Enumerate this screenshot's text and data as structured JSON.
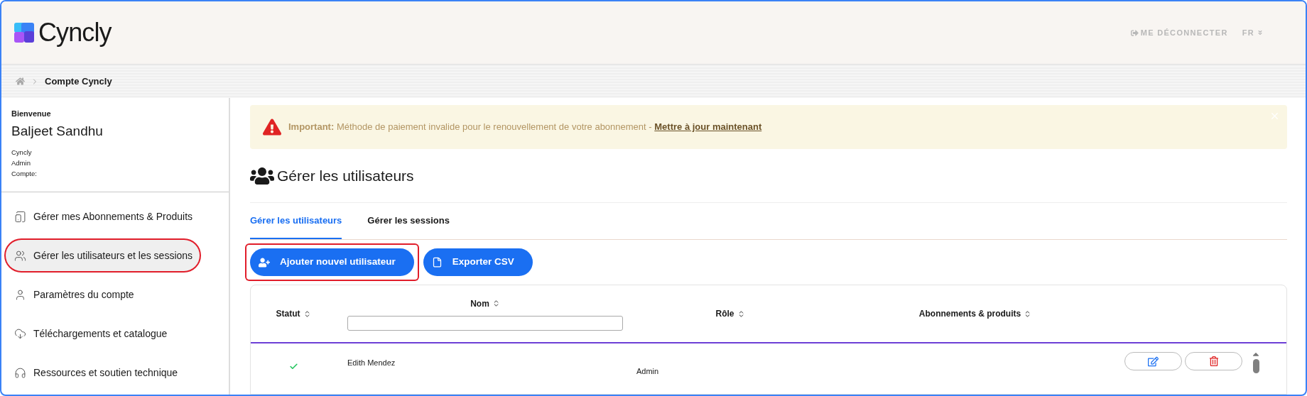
{
  "header": {
    "logo_text": "Cyncly",
    "logout": "ME DÉCONNECTER",
    "language": "FR"
  },
  "breadcrumb": [
    "Compte Cyncly"
  ],
  "sidebar": {
    "greeting": "Bienvenue",
    "user_name": "Baljeet Sandhu",
    "details": [
      "Cyncly",
      "Admin",
      "Compte:"
    ],
    "items": [
      {
        "label": "Gérer mes Abonnements & Produits",
        "kind": "devices",
        "selected": false,
        "highlighted": false
      },
      {
        "label": "Gérer les utilisateurs et les sessions",
        "kind": "users",
        "selected": true,
        "highlighted": true
      },
      {
        "label": "Paramètres du compte",
        "kind": "user",
        "selected": false,
        "highlighted": false
      },
      {
        "label": "Téléchargements et catalogue",
        "kind": "cloud",
        "selected": false,
        "highlighted": false
      },
      {
        "label": "Ressources et soutien technique",
        "kind": "headset",
        "selected": false,
        "highlighted": false
      }
    ]
  },
  "alert": {
    "label": "Important:",
    "message": "Méthode de paiement invalide pour le renouvellement de votre abonnement -",
    "link": "Mettre à jour maintenant"
  },
  "page_title": "Gérer les utilisateurs",
  "tabs": [
    {
      "label": "Gérer les utilisateurs",
      "selected": true
    },
    {
      "label": "Gérer les sessions",
      "selected": false
    }
  ],
  "actions": [
    {
      "label": "Ajouter nouvel utilisateur",
      "kind": "add",
      "highlighted": true
    },
    {
      "label": "Exporter CSV",
      "kind": "export",
      "highlighted": false
    }
  ],
  "table": {
    "columns": [
      {
        "label": "Statut",
        "kind": "sort"
      },
      {
        "label": "Nom",
        "kind": "filter"
      },
      {
        "label": "Rôle",
        "kind": "sort"
      },
      {
        "label": "Abonnements & produits",
        "kind": "sort"
      }
    ],
    "rows": [
      {
        "active": true,
        "name": "Edith Mendez",
        "role": "Admin"
      }
    ]
  }
}
